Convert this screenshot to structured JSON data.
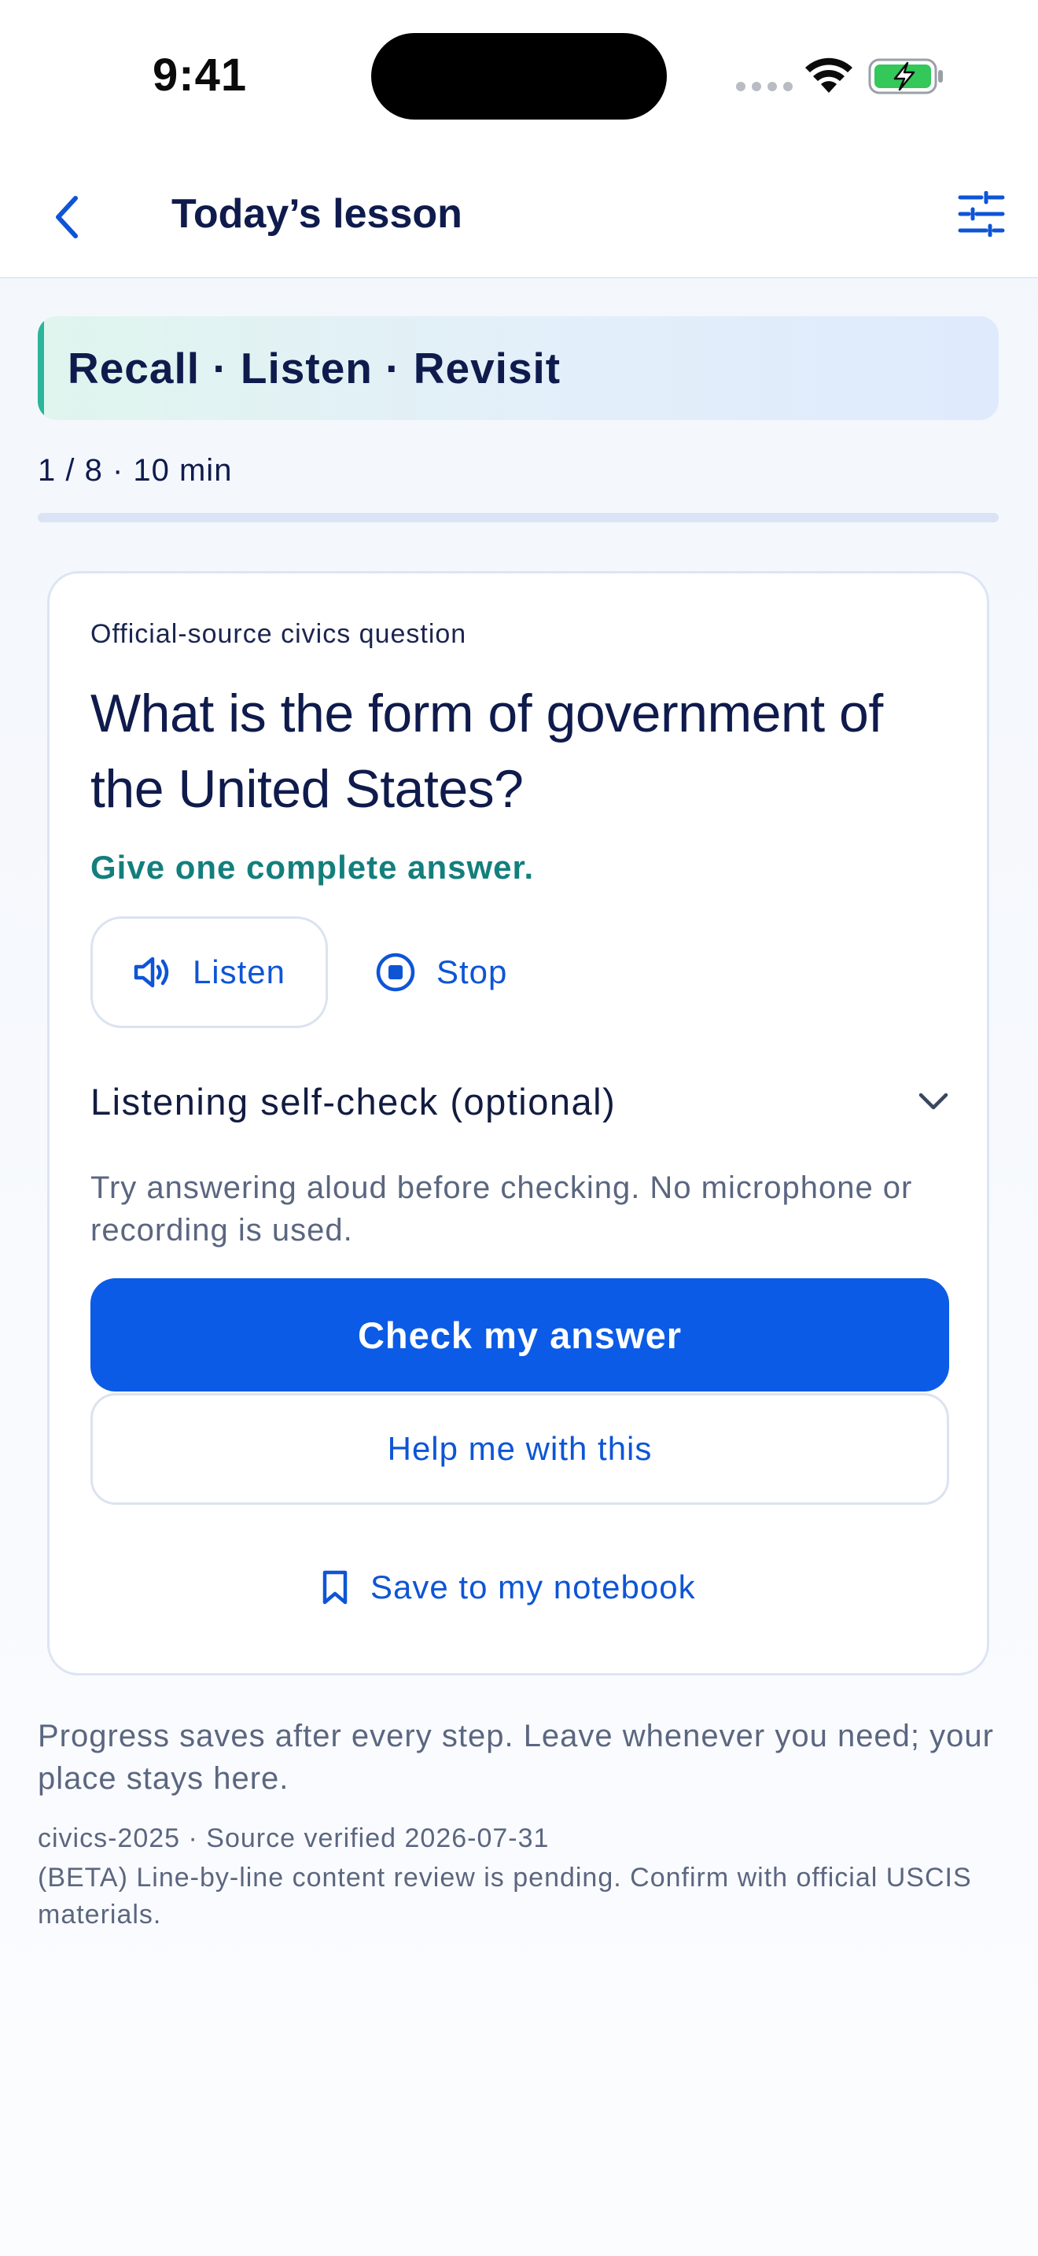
{
  "status_bar": {
    "time": "9:41"
  },
  "header": {
    "title": "Today’s lesson",
    "back_icon": "chevron-left-icon",
    "settings_icon": "sliders-icon"
  },
  "banner": {
    "text": "Recall · Listen · Revisit"
  },
  "progress": {
    "text": "1 / 8 · 10 min",
    "current_step": 1,
    "total_steps": 8,
    "fraction": 0
  },
  "card": {
    "eyebrow": "Official-source civics question",
    "question": "What is the form of government of the United States?",
    "hint": "Give one complete answer.",
    "listen_label": "Listen",
    "stop_label": "Stop",
    "selfcheck_label": "Listening self-check (optional)",
    "helper": "Try answering aloud before checking. No microphone or recording is used.",
    "check_label": "Check my answer",
    "help_label": "Help me with this",
    "save_label": "Save to my notebook"
  },
  "footer": {
    "note": "Progress saves after every step. Leave whenever you need; your place stays here.",
    "source": "civics-2025 · Source verified 2026-07-31",
    "beta_notice": "(BETA) Line-by-line content review is pending. Confirm with official USCIS materials."
  },
  "colors": {
    "accent": "#0b5be6",
    "teal": "#137f7d",
    "text": "#0f1b4c",
    "muted": "#5b6680"
  }
}
